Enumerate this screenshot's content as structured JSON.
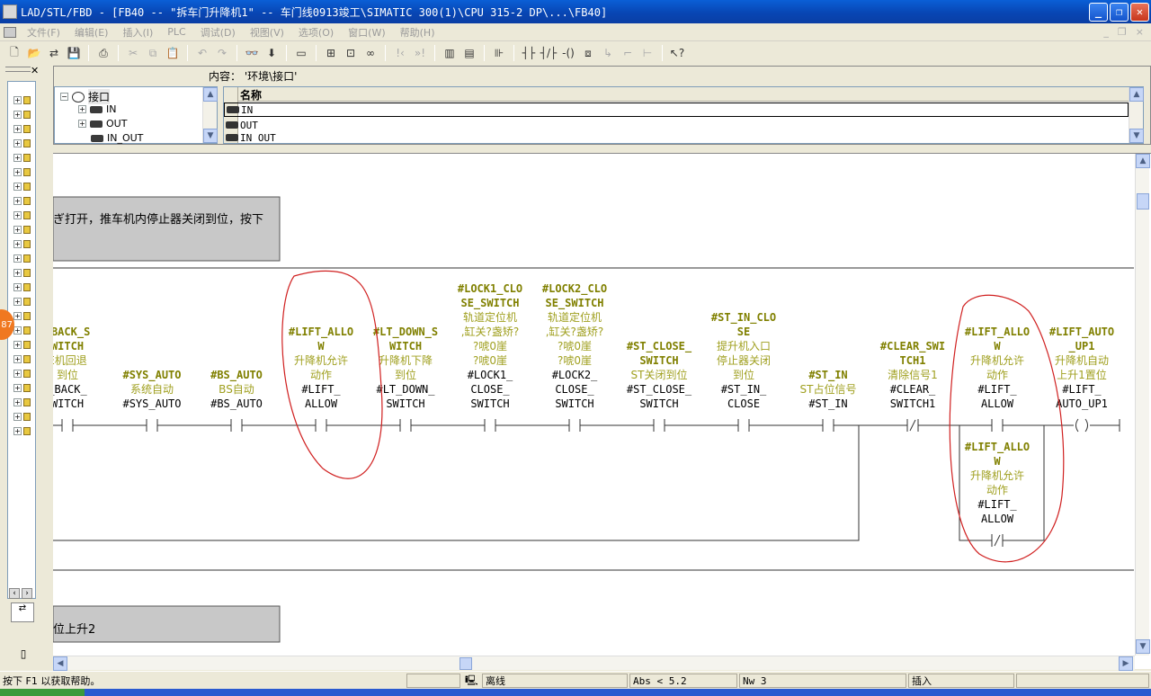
{
  "window": {
    "title": "LAD/STL/FBD  - [FB40 -- \"拆车门升降机1\" -- 车门线0913竣工\\SIMATIC 300(1)\\CPU 315-2 DP\\...\\FB40]",
    "min_label": "_",
    "max_label": "❐",
    "close_label": "✕"
  },
  "menu": {
    "items": [
      "文件(F)",
      "编辑(E)",
      "插入(I)",
      "PLC",
      "调试(D)",
      "视图(V)",
      "选项(O)",
      "窗口(W)",
      "帮助(H)"
    ],
    "mdi": [
      "_",
      "❐",
      "×"
    ]
  },
  "toolbar": {
    "buttons": [
      "new",
      "open",
      "online",
      "save",
      "print",
      "cut",
      "copy",
      "paste",
      "undo",
      "redo",
      "monitor",
      "download",
      "comment-toggle",
      "network",
      "overview",
      "first",
      "prev",
      "next",
      "window1",
      "window2",
      "catalog",
      "contact-no",
      "contact-nc",
      "coil",
      "box",
      "branch-open",
      "branch-close",
      "connect",
      "help-pointer"
    ]
  },
  "left_panel": {
    "orange_badge": "87",
    "buttons": [
      "‹",
      "›"
    ],
    "bottom_icon": "▯"
  },
  "interface_panel": {
    "content_label": "内容：",
    "content_path": "'环境\\接口'",
    "tree": {
      "root": "接口",
      "children": [
        "IN",
        "OUT",
        "IN_OUT"
      ]
    },
    "table": {
      "header": "名称",
      "rows": [
        "IN",
        "OUT",
        "IN_OUT"
      ]
    }
  },
  "network_comments": {
    "first": "ぎ打开，推车机内停止器关闭到位，按下",
    "second": "位上升2"
  },
  "ladder": {
    "contacts": [
      {
        "top": "",
        "sym1": "_BACK_S",
        "sym2": "WITCH",
        "cmt1": "E机回退",
        "cmt2": "到位",
        "addr1": "_BACK_",
        "addr2": "WITCH",
        "type": "NO"
      },
      {
        "sym1": "#SYS_AUTO",
        "cmt1": "系统自动",
        "addr1": "#SYS_AUTO",
        "type": "NO"
      },
      {
        "sym1": "#BS_AUTO",
        "cmt1": "BS自动",
        "addr1": "#BS_AUTO",
        "type": "NO"
      },
      {
        "sym1": "#LIFT_ALLO",
        "sym2": "W",
        "cmt1": "升降机允许",
        "cmt2": "动作",
        "addr1": "#LIFT_",
        "addr2": "ALLOW",
        "type": "NO"
      },
      {
        "sym1": "#LT_DOWN_S",
        "sym2": "WITCH",
        "cmt1": "升降机下降",
        "cmt2": "到位",
        "addr1": "#LT_DOWN_",
        "addr2": "SWITCH",
        "type": "NO"
      },
      {
        "sym1": "#LOCK1_CLO",
        "sym2": "SE_SWITCH",
        "cmt1": "轨道定位机",
        "cmt2": ",缸关?盏矫?",
        "cmt3": "?唬0崖",
        "cmt4": "?唬0崖",
        "addr1": "#LOCK1_",
        "addr2": "CLOSE_",
        "addr3": "SWITCH",
        "type": "NO"
      },
      {
        "sym1": "#LOCK2_CLO",
        "sym2": "SE_SWITCH",
        "cmt1": "轨道定位机",
        "cmt2": ",缸关?盏矫?",
        "cmt3": "?唬0崖",
        "cmt4": "?唬0崖",
        "addr1": "#LOCK2_",
        "addr2": "CLOSE_",
        "addr3": "SWITCH",
        "type": "NO"
      },
      {
        "sym1": "#ST_CLOSE_",
        "sym2": "SWITCH",
        "cmt1": "ST关闭到位",
        "addr1": "#ST_CLOSE_",
        "addr2": "SWITCH",
        "type": "NO"
      },
      {
        "sym1": "#ST_IN_CLO",
        "sym2": "SE",
        "cmt1": "提升机入口",
        "cmt2": "停止器关闭",
        "cmt3": "到位",
        "addr1": "#ST_IN_",
        "addr2": "CLOSE",
        "type": "NO"
      },
      {
        "sym1": "#ST_IN",
        "cmt1": "ST占位信号",
        "addr1": "#ST_IN",
        "type": "NO"
      },
      {
        "sym1": "#CLEAR_SWI",
        "sym2": "TCH1",
        "cmt1": "清除信号1",
        "addr1": "#CLEAR_",
        "addr2": "SWITCH1",
        "type": "NC"
      },
      {
        "sym1": "#LIFT_ALLO",
        "sym2": "W",
        "cmt1": "升降机允许",
        "cmt2": "动作",
        "addr1": "#LIFT_",
        "addr2": "ALLOW",
        "type": "NO"
      },
      {
        "sym1": "#LIFT_AUTO",
        "sym2": "_UP1",
        "cmt1": "升降机自动",
        "cmt2": "上升1置位",
        "addr1": "#LIFT_",
        "addr2": "AUTO_UP1",
        "type": "COIL"
      }
    ],
    "branch": {
      "sym1": "#LIFT_ALLO",
      "sym2": "W",
      "cmt1": "升降机允许",
      "cmt2": "动作",
      "addr1": "#LIFT_",
      "addr2": "ALLOW",
      "type": "NC"
    }
  },
  "statusbar": {
    "help": "按下 F1 以获取帮助。",
    "mode": "离线",
    "abs": "Abs < 5.2",
    "nw": "Nw 3",
    "insert": "插入"
  },
  "colors": {
    "symbol": "#808000",
    "comment": "#a0a020",
    "address": "#000000",
    "annotation": "#d02020"
  }
}
